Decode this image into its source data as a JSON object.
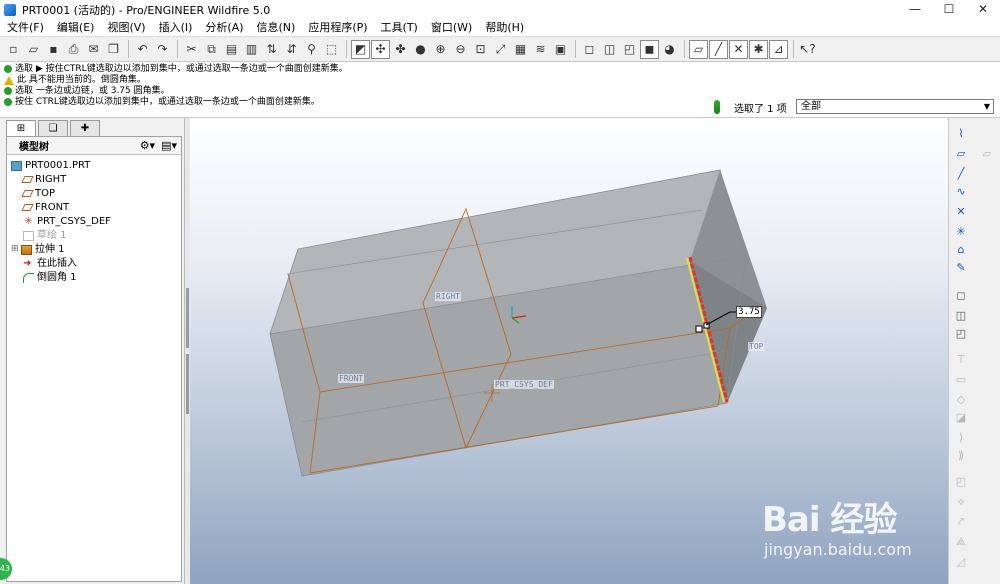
{
  "window": {
    "title": "PRT0001 (活动的) - Pro/ENGINEER Wildfire 5.0",
    "minimize_glyph": "—",
    "maximize_glyph": "☐",
    "close_glyph": "✕"
  },
  "menu": [
    "文件(F)",
    "编辑(E)",
    "视图(V)",
    "插入(I)",
    "分析(A)",
    "信息(N)",
    "应用程序(P)",
    "工具(T)",
    "窗口(W)",
    "帮助(H)"
  ],
  "toolbar_icons": [
    "new-icon",
    "open-icon",
    "save-icon",
    "print-icon",
    "email-icon",
    "copy-icon",
    "undo-icon",
    "redo-icon",
    "cut-icon",
    "copy-icon",
    "paste-icon",
    "paste-special-icon",
    "regenerate-icon",
    "search-icon",
    "select-box-icon",
    "repaint-icon",
    "spin-center-icon",
    "orient-icon",
    "appearance-icon",
    "zoom-in-icon",
    "zoom-out-icon",
    "refit-icon",
    "reorient-icon",
    "view-manager-icon",
    "layers-icon",
    "saved-views-icon",
    "wireframe-icon",
    "hidden-line-icon",
    "no-hidden-icon",
    "shading-icon",
    "enhanced-realism-icon",
    "datum-planes-icon",
    "datum-axes-icon",
    "datum-points-icon",
    "csys-icon",
    "help-icon"
  ],
  "messages": [
    {
      "icon": "info",
      "text": "选取 ▶ 按住CTRL键选取边以添加到集中，或通过选取一条边或一个曲面创建新集。"
    },
    {
      "icon": "warn",
      "text": "此 具不能用当前的。倒圆角集。"
    },
    {
      "icon": "info",
      "text": "选取 一条边或边链，或 3.75       圆角集。"
    },
    {
      "icon": "info",
      "text": "按住 CTRL键选取边以添加到集中，或通过选取一条边或一个曲面创建新集。"
    }
  ],
  "selection": {
    "status": "选取了 1 项",
    "filter": "全部"
  },
  "panel_tabs": [
    "model-tree-tab-icon",
    "folder-browser-tab-icon",
    "favorites-tab-icon"
  ],
  "model_tree": {
    "header": "模型树",
    "items": [
      {
        "label": "PRT0001.PRT",
        "icon": "part-icon",
        "indent": 0,
        "disabled": false
      },
      {
        "label": "RIGHT",
        "icon": "datum-plane-icon",
        "indent": 1,
        "disabled": false
      },
      {
        "label": "TOP",
        "icon": "datum-plane-icon",
        "indent": 1,
        "disabled": false
      },
      {
        "label": "FRONT",
        "icon": "datum-plane-icon",
        "indent": 1,
        "disabled": false
      },
      {
        "label": "PRT_CSYS_DEF",
        "icon": "csys-icon",
        "indent": 1,
        "disabled": false
      },
      {
        "label": "草绘 1",
        "icon": "sketch-icon",
        "indent": 1,
        "disabled": true
      },
      {
        "label": "拉伸 1",
        "icon": "extrude-icon",
        "indent": 1,
        "disabled": false,
        "expandable": true
      },
      {
        "label": "在此插入",
        "icon": "insert-here-icon",
        "indent": 1,
        "disabled": false
      },
      {
        "label": "倒圆角 1",
        "icon": "round-icon",
        "indent": 1,
        "disabled": false
      }
    ]
  },
  "viewport": {
    "plane_labels": {
      "right": "RIGHT",
      "front": "FRONT",
      "top": "TOP",
      "csys": "PRT_CSYS_DEF"
    },
    "round_radius": "3.75"
  },
  "side_badge": "43",
  "watermark": {
    "brand": "Bai 经验",
    "url": "jingyan.baidu.com"
  }
}
